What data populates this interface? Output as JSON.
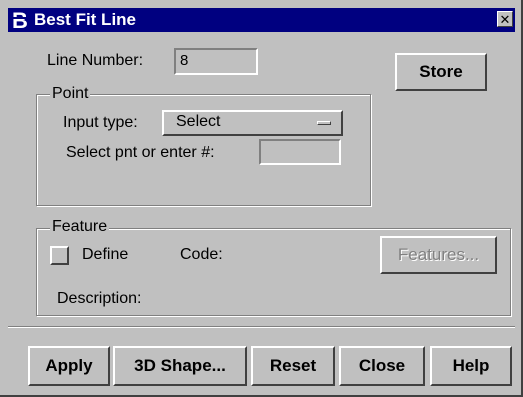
{
  "window": {
    "title": "Best Fit Line",
    "close_glyph": "✕"
  },
  "line_number": {
    "label": "Line Number:",
    "value": "8"
  },
  "store_button": "Store",
  "point_group": {
    "title": "Point",
    "input_type_label": "Input type:",
    "input_type_value": "Select",
    "select_label": "Select pnt or enter #:",
    "select_value": ""
  },
  "feature_group": {
    "title": "Feature",
    "define_label": "Define",
    "code_label": "Code:",
    "features_button": "Features...",
    "description_label": "Description:"
  },
  "buttons": {
    "apply": "Apply",
    "shape3d": "3D Shape...",
    "reset": "Reset",
    "close": "Close",
    "help": "Help"
  },
  "colors": {
    "titlebar": "#000080",
    "window": "#c0c0c0",
    "disabled_text": "#808080"
  },
  "icons": {
    "app": "bentley-b-icon",
    "close": "close-icon"
  }
}
